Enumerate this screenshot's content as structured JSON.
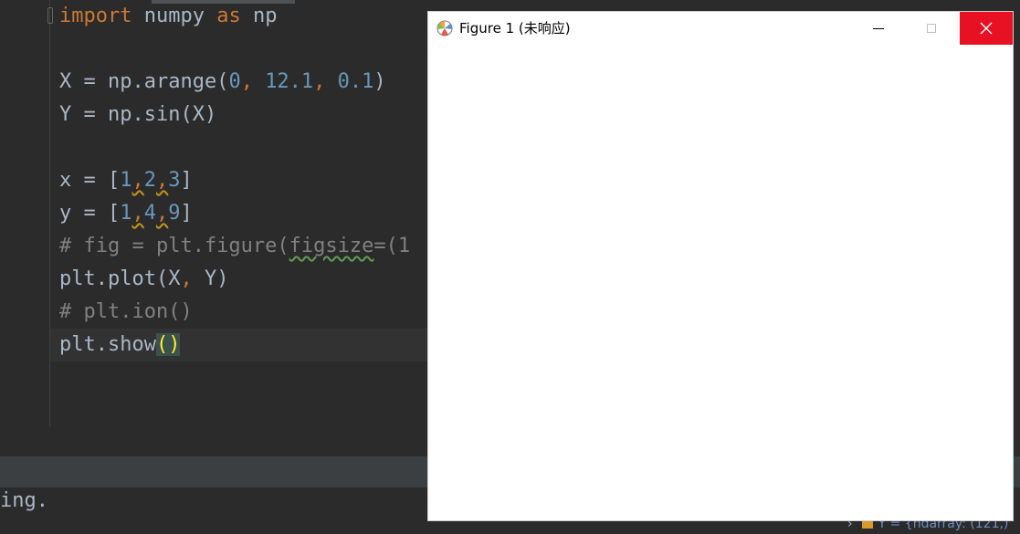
{
  "editor": {
    "lines": [
      {
        "tokens": [
          {
            "t": "import",
            "c": "kw"
          },
          {
            "t": " numpy "
          },
          {
            "t": "as",
            "c": "kw"
          },
          {
            "t": " np"
          }
        ]
      },
      {
        "tokens": []
      },
      {
        "tokens": [
          {
            "t": "X = np.arange("
          },
          {
            "t": "0",
            "c": "num"
          },
          {
            "t": ", ",
            "c": "kw"
          },
          {
            "t": "12.1",
            "c": "num"
          },
          {
            "t": ", ",
            "c": "kw"
          },
          {
            "t": "0.1",
            "c": "num"
          },
          {
            "t": ")"
          }
        ]
      },
      {
        "tokens": [
          {
            "t": "Y = np.sin(X)"
          }
        ]
      },
      {
        "tokens": []
      },
      {
        "tokens": [
          {
            "t": "x = ["
          },
          {
            "t": "1",
            "c": "num"
          },
          {
            "t": ",",
            "c": "kw squig"
          },
          {
            "t": "2",
            "c": "num"
          },
          {
            "t": ",",
            "c": "kw squig"
          },
          {
            "t": "3",
            "c": "num"
          },
          {
            "t": "]"
          }
        ]
      },
      {
        "tokens": [
          {
            "t": "y = ["
          },
          {
            "t": "1",
            "c": "num"
          },
          {
            "t": ",",
            "c": "kw squig"
          },
          {
            "t": "4",
            "c": "num"
          },
          {
            "t": ",",
            "c": "kw squig"
          },
          {
            "t": "9",
            "c": "num"
          },
          {
            "t": "]"
          }
        ]
      },
      {
        "tokens": [
          {
            "t": "# fig = plt.figure(",
            "c": "cm"
          },
          {
            "t": "figsize",
            "c": "cm squig-green"
          },
          {
            "t": "=(1",
            "c": "cm"
          }
        ]
      },
      {
        "tokens": [
          {
            "t": "plt.plot(X"
          },
          {
            "t": ", ",
            "c": "kw"
          },
          {
            "t": "Y)"
          }
        ]
      },
      {
        "tokens": [
          {
            "t": "# plt.ion()",
            "c": "cm"
          }
        ]
      },
      {
        "tokens": [
          {
            "t": "plt.show"
          },
          {
            "t": "()",
            "c": "paren"
          }
        ]
      }
    ]
  },
  "console": {
    "text": "ing."
  },
  "variables": {
    "row_text": "Y = {ndarray: (121,)"
  },
  "figure_window": {
    "title": "Figure 1 (未响应)",
    "minimize_icon": "minimize-icon",
    "maximize_icon": "maximize-icon",
    "close_icon": "close-icon",
    "close_color": "#e81123"
  }
}
